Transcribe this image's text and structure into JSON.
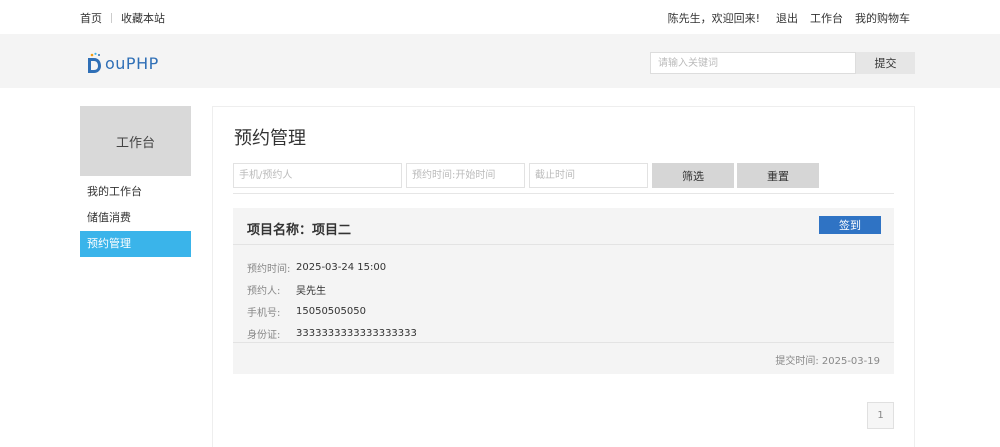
{
  "topbar": {
    "home": "首页",
    "bookmark": "收藏本站",
    "welcome": "陈先生，欢迎回来!",
    "logout": "退出",
    "workbench": "工作台",
    "cart": "我的购物车"
  },
  "header": {
    "logo_text": "ouPHP",
    "search_placeholder": "请输入关键词",
    "search_button": "提交"
  },
  "sidebar": {
    "title": "工作台",
    "items": [
      {
        "label": "我的工作台",
        "active": false
      },
      {
        "label": "储值消费",
        "active": false
      },
      {
        "label": "预约管理",
        "active": true
      }
    ]
  },
  "main": {
    "title": "预约管理",
    "filters": {
      "phone_placeholder": "手机/预约人",
      "start_placeholder": "预约时间:开始时间",
      "end_placeholder": "截止时间",
      "filter_button": "筛选",
      "reset_button": "重置"
    },
    "card": {
      "title": "项目名称：项目二",
      "checkin_button": "签到",
      "fields": [
        {
          "label": "预约时间:",
          "value": "2025-03-24 15:00"
        },
        {
          "label": "预约人:",
          "value": "吴先生"
        },
        {
          "label": "手机号:",
          "value": "15050505050"
        },
        {
          "label": "身份证:",
          "value": "3333333333333333333"
        }
      ],
      "submit_time": "提交时间:  2025-03-19"
    },
    "pagination": {
      "current": "1"
    }
  },
  "colors": {
    "accent_blue": "#3ab4ea",
    "button_blue": "#2f73c4",
    "logo_blue": "#2f6fb6"
  }
}
